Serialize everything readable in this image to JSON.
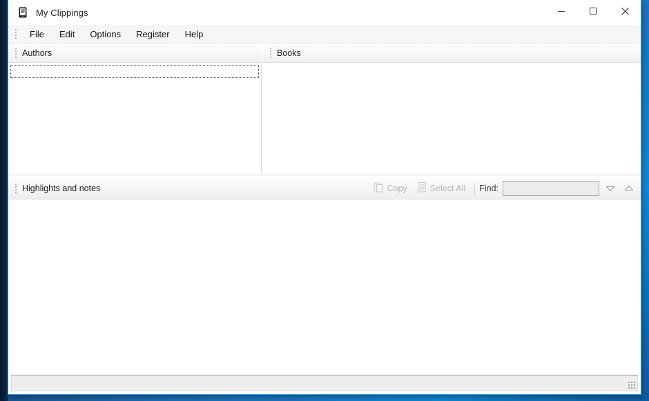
{
  "window": {
    "title": "My Clippings",
    "app_icon": "ereader-icon",
    "controls": {
      "minimize": "minimize-icon",
      "maximize": "maximize-icon",
      "close": "close-icon"
    }
  },
  "menubar": {
    "grip": "menu-drag-grip",
    "items": [
      {
        "label": "File"
      },
      {
        "label": "Edit"
      },
      {
        "label": "Options"
      },
      {
        "label": "Register"
      },
      {
        "label": "Help"
      }
    ]
  },
  "panes": {
    "authors": {
      "title": "Authors",
      "grip": "pane-drag-grip",
      "items": [],
      "focused_row_empty": true
    },
    "books": {
      "title": "Books",
      "grip": "pane-drag-grip",
      "items": []
    },
    "notes": {
      "title": "Highlights and notes",
      "grip": "pane-drag-grip",
      "content": "",
      "toolbar": {
        "copy_label": "Copy",
        "copy_icon": "copy-pages-icon",
        "copy_enabled": false,
        "select_all_label": "Select All",
        "select_all_icon": "document-lines-icon",
        "select_all_enabled": false,
        "find_label": "Find:",
        "find_value": "",
        "find_placeholder": "",
        "find_next_icon": "triangle-down-icon",
        "find_prev_icon": "triangle-up-icon"
      }
    }
  },
  "statusbar": {
    "text": "",
    "grip": "resize-grip"
  },
  "colors": {
    "window_border": "#3b9cdc",
    "desktop_top": "#0a2440",
    "desktop_accent": "#1288d4",
    "header_bg": "#f6f6f6",
    "disabled_text": "#b6b6b6"
  }
}
